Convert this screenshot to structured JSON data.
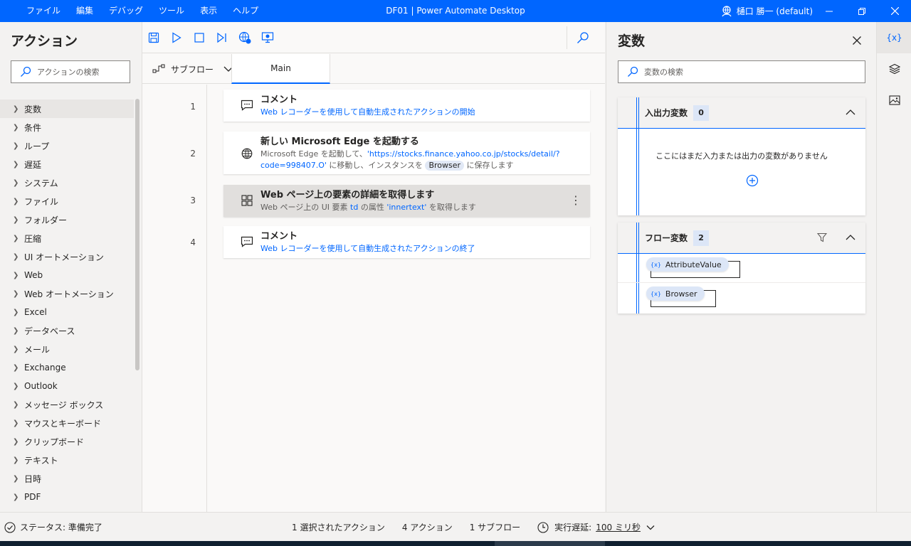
{
  "titlebar": {
    "menus": [
      "ファイル",
      "編集",
      "デバッグ",
      "ツール",
      "表示",
      "ヘルプ"
    ],
    "title": "DF01 | Power Automate Desktop",
    "user": "樋口 勝一 (default)"
  },
  "actions_panel": {
    "title": "アクション",
    "search_placeholder": "アクションの検索",
    "categories": [
      "変数",
      "条件",
      "ループ",
      "遅延",
      "システム",
      "ファイル",
      "フォルダー",
      "圧縮",
      "UI オートメーション",
      "Web",
      "Web オートメーション",
      "Excel",
      "データベース",
      "メール",
      "Exchange",
      "Outlook",
      "メッセージ ボックス",
      "マウスとキーボード",
      "クリップボード",
      "テキスト",
      "日時",
      "PDF"
    ]
  },
  "tabs": {
    "subflow_label": "サブフロー",
    "main_tab": "Main"
  },
  "steps": [
    {
      "line": "1",
      "icon": "comment-icon",
      "title": "コメント",
      "desc": "Web レコーダーを使用して自動生成されたアクションの開始"
    },
    {
      "line": "2",
      "icon": "globe-icon",
      "title": "新しい Microsoft Edge を起動する",
      "desc_a": "Microsoft Edge を起動して、",
      "desc_url_1": "'https://stocks.finance.yahoo.co.jp/stocks/detail/?",
      "desc_url_2": "code=998407.O'",
      "desc_b": " に移動し、インスタンスを ",
      "desc_pill": "Browser",
      "desc_c": " に保存します"
    },
    {
      "line": "3",
      "icon": "web-element-icon",
      "title": "Web ページ上の要素の詳細を取得します",
      "desc_a": "Web ページ上の UI 要素 ",
      "desc_td": "td",
      "desc_b": " の属性 ",
      "desc_attr": "'innertext'",
      "desc_c": " を取得します"
    },
    {
      "line": "4",
      "icon": "comment-icon",
      "title": "コメント",
      "desc": "Web レコーダーを使用して自動生成されたアクションの終了"
    }
  ],
  "variables": {
    "title": "変数",
    "search_placeholder": "変数の検索",
    "io_section": {
      "title": "入出力変数",
      "count": "0",
      "empty_message": "ここにはまだ入力または出力の変数がありません"
    },
    "flow_section": {
      "title": "フロー変数",
      "count": "2",
      "items": [
        "AttributeValue",
        "Browser"
      ]
    },
    "var_symbol": "{x}"
  },
  "rail": {
    "vars_label": "{x}"
  },
  "statusbar": {
    "status": "ステータス: 準備完了",
    "selected": "1 選択されたアクション",
    "actions": "4 アクション",
    "subflows": "1 サブフロー",
    "delay_label": "実行遅延:",
    "delay_value": "100 ミリ秒"
  },
  "colors": {
    "accent": "#0066ff",
    "link": "#0066ff",
    "selected_step": "#e1dfdd"
  }
}
